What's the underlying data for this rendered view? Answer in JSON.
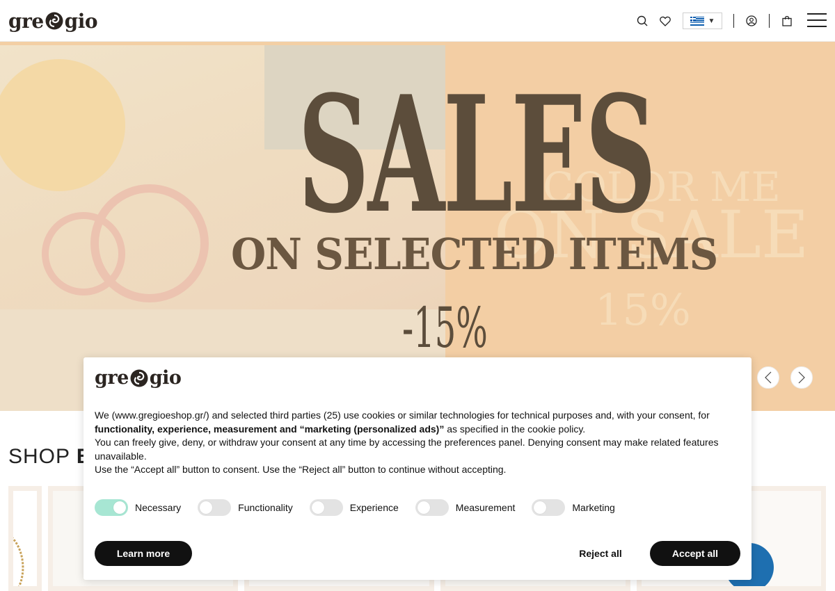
{
  "header": {
    "logo_left": "gre",
    "logo_right": "gio",
    "language_flag": "greek-flag",
    "icons": [
      "search-icon",
      "heart-icon",
      "user-icon",
      "bag-icon",
      "menu-icon"
    ]
  },
  "hero": {
    "headline": "SALES",
    "subline": "ON SELECTED ITEMS",
    "discount": "-15%",
    "ghost_line1": "COLOR ME",
    "ghost_line2": "ON SALE",
    "ghost_line3": "15%",
    "prev_icon": "chevron-left-icon",
    "next_icon": "chevron-right-icon"
  },
  "shop": {
    "title_light": "SHOP ",
    "title_bold": "B"
  },
  "cookie": {
    "logo_left": "gre",
    "logo_right": "gio",
    "p1_start": "We (www.gregioeshop.gr/) and selected third parties (25) use cookies or similar technologies for technical purposes and, with your consent, for ",
    "p1_bold": "functionality, experience, measurement and “marketing (personalized ads)”",
    "p1_end": " as specified in the cookie policy.",
    "p2": "You can freely give, deny, or withdraw your consent at any time by accessing the preferences panel. Denying consent may make related features unavailable.",
    "p3": "Use the “Accept all” button to consent. Use the “Reject all” button to continue without accepting.",
    "toggles": [
      {
        "label": "Necessary",
        "on": true
      },
      {
        "label": "Functionality",
        "on": false
      },
      {
        "label": "Experience",
        "on": false
      },
      {
        "label": "Measurement",
        "on": false
      },
      {
        "label": "Marketing",
        "on": false
      }
    ],
    "learn_more": "Learn more",
    "reject_all": "Reject all",
    "accept_all": "Accept all"
  },
  "colors": {
    "brand_dark": "#2b2521",
    "toggle_on": "#a7e6d3",
    "hero_peach": "#f3cea4"
  }
}
